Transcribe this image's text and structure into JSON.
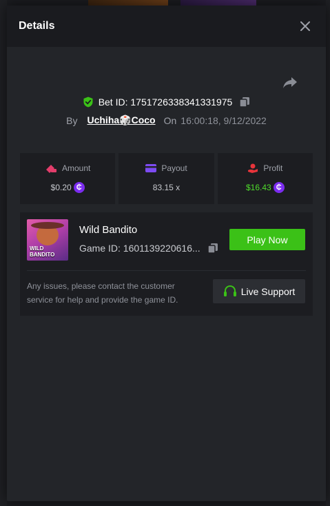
{
  "modal": {
    "title": "Details"
  },
  "bet": {
    "label": "Bet ID: 1751726338341331975",
    "by_label": "By",
    "username": "Uchiha🎲Coco",
    "on_label": "On",
    "timestamp": "16:00:18, 9/12/2022"
  },
  "stats": {
    "amount": {
      "label": "Amount",
      "value": "$0.20"
    },
    "payout": {
      "label": "Payout",
      "value": "83.15 x"
    },
    "profit": {
      "label": "Profit",
      "value": "$16.43"
    }
  },
  "coin_symbol": "₵",
  "game": {
    "name": "Wild Bandito",
    "id_text": "Game ID: 1601139220616...",
    "thumb_text": "WILD BANDITO",
    "play_label": "Play Now"
  },
  "support": {
    "text": "Any issues, please contact the customer service for help and provide the game ID.",
    "button_label": "Live Support"
  },
  "colors": {
    "accent_green": "#3bc117",
    "profit_green": "#4fdc2b",
    "coin_purple": "#7b2cf0",
    "amount_icon": "#e33d6b",
    "payout_icon": "#7d4bf2",
    "profit_icon": "#e8343b"
  },
  "icons": {
    "close": "close-icon",
    "share": "share-icon",
    "verified": "shield-check-icon",
    "copy": "copy-icon",
    "amount": "wallet-icon",
    "payout": "card-icon",
    "profit": "hand-coin-icon",
    "support": "headset-icon"
  }
}
